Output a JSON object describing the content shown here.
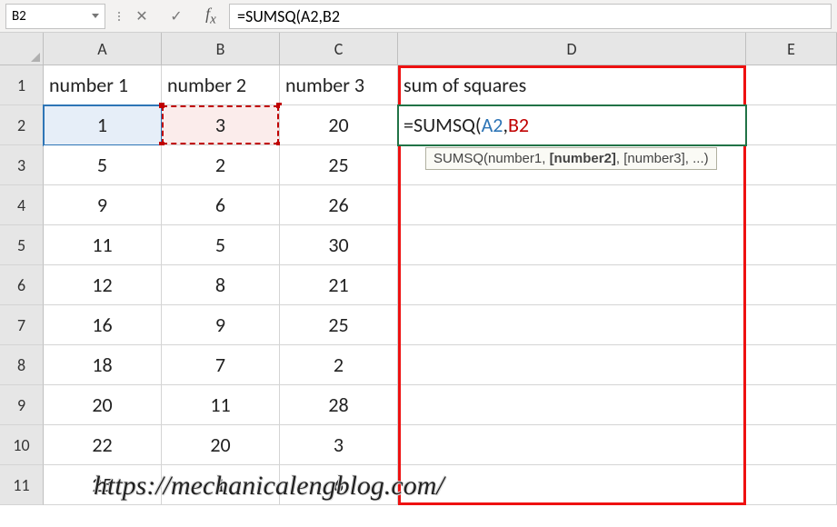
{
  "name_box": "B2",
  "formula_bar": "=SUMSQ(A2,B2",
  "columns": [
    "A",
    "B",
    "C",
    "D",
    "E"
  ],
  "rows": [
    "1",
    "2",
    "3",
    "4",
    "5",
    "6",
    "7",
    "8",
    "9",
    "10",
    "11"
  ],
  "headers": {
    "A": "number 1",
    "B": "number 2",
    "C": "number 3",
    "D": "sum of squares"
  },
  "table": [
    {
      "A": "1",
      "B": "3",
      "C": "20"
    },
    {
      "A": "5",
      "B": "2",
      "C": "25"
    },
    {
      "A": "9",
      "B": "6",
      "C": "26"
    },
    {
      "A": "11",
      "B": "5",
      "C": "30"
    },
    {
      "A": "12",
      "B": "8",
      "C": "21"
    },
    {
      "A": "16",
      "B": "9",
      "C": "25"
    },
    {
      "A": "18",
      "B": "7",
      "C": "2"
    },
    {
      "A": "20",
      "B": "11",
      "C": "28"
    },
    {
      "A": "22",
      "B": "20",
      "C": "3"
    },
    {
      "A": "25",
      "B": "1",
      "C": "6"
    }
  ],
  "editing_formula": {
    "prefix": "=SUMSQ(",
    "ref1": "A2",
    "sep": ",",
    "ref2": "B2"
  },
  "tooltip": {
    "fn": "SUMSQ",
    "a1": "number1",
    "a2": "[number2]",
    "a3": "[number3]",
    "rest": ", ...)"
  },
  "watermark": "https://mechanicalengblog.com/"
}
